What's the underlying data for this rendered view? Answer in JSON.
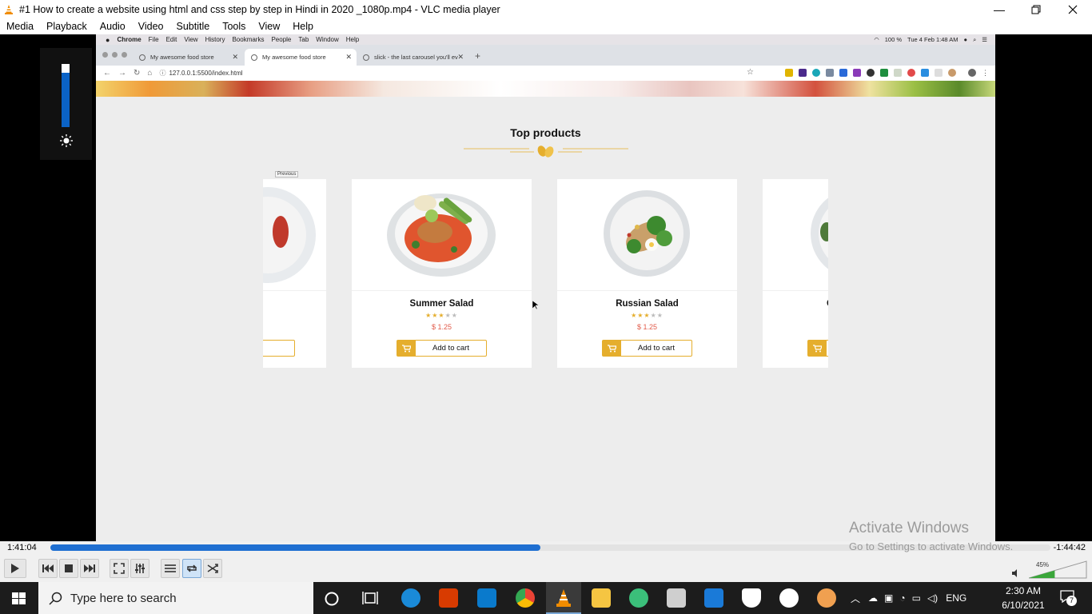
{
  "vlc": {
    "window_title": "#1 How to create a website using html and css step by step in Hindi in 2020 _1080p.mp4 - VLC media player",
    "menu": [
      "Media",
      "Playback",
      "Audio",
      "Video",
      "Subtitle",
      "Tools",
      "View",
      "Help"
    ],
    "time_elapsed": "1:41:04",
    "time_remaining": "-1:44:42",
    "seek_progress_percent": 49,
    "volume_percent": "45%",
    "volume_overlay_level_percent": 86
  },
  "mac_menubar": {
    "app": "Chrome",
    "items": [
      "File",
      "Edit",
      "View",
      "History",
      "Bookmarks",
      "People",
      "Tab",
      "Window",
      "Help"
    ],
    "battery": "100 %",
    "datetime": "Tue 4 Feb  1:48 AM"
  },
  "chrome": {
    "tabs": [
      {
        "title": "My awesome food store"
      },
      {
        "title": "My awesome food store"
      },
      {
        "title": "slick - the last carousel you'll ev"
      }
    ],
    "new_tab": "+",
    "url": "127.0.0.1:5500/index.html"
  },
  "page": {
    "section_title": "Top products",
    "previous_button": "Previous",
    "products": [
      {
        "name": "Summer Salad",
        "price": "$ 1.25",
        "rating": 3,
        "max_rating": 5,
        "button": "Add to cart"
      },
      {
        "name": "Russian Salad",
        "price": "$ 1.25",
        "rating": 3,
        "max_rating": 5,
        "button": "Add to cart"
      }
    ],
    "partial_right_name": "C"
  },
  "watermark": {
    "line1": "Activate Windows",
    "line2": "Go to Settings to activate Windows."
  },
  "taskbar": {
    "search_placeholder": "Type here to search",
    "language": "ENG",
    "time": "2:30 AM",
    "date": "6/10/2021",
    "notifications": "7"
  },
  "colors": {
    "accent_yellow": "#e5ae2d",
    "price_red": "#e25b4a",
    "vlc_blue": "#1f6fd1"
  }
}
